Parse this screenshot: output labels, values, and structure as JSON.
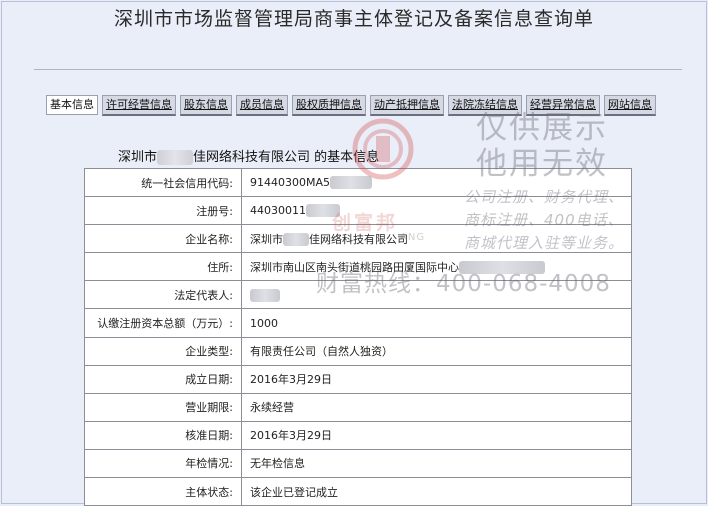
{
  "page": {
    "title": "深圳市市场监督管理局商事主体登记及备案信息查询单"
  },
  "tabs": [
    {
      "label": "基本信息",
      "active": true
    },
    {
      "label": "许可经营信息"
    },
    {
      "label": "股东信息"
    },
    {
      "label": "成员信息"
    },
    {
      "label": "股权质押信息"
    },
    {
      "label": "动产抵押信息"
    },
    {
      "label": "法院冻结信息"
    },
    {
      "label": "经营异常信息"
    },
    {
      "label": "网站信息"
    }
  ],
  "company": {
    "prefix": "深圳市",
    "suffix": "佳网络科技有限公司",
    "heading_tail": "的基本信息"
  },
  "rows": {
    "credit_code": {
      "label": "统一社会信用代码:",
      "value": "91440300MA5"
    },
    "reg_no": {
      "label": "注册号:",
      "value": "44030011"
    },
    "name": {
      "label": "企业名称:",
      "prefix": "深圳市",
      "suffix": "佳网络科技有限公司"
    },
    "address": {
      "label": "住所:",
      "value": "深圳市南山区南头街道桃园路田厦国际中心"
    },
    "legal_rep": {
      "label": "法定代表人:"
    },
    "capital": {
      "label": "认缴注册资本总额（万元）:",
      "value": "1000"
    },
    "type": {
      "label": "企业类型:",
      "value": "有限责任公司（自然人独资）"
    },
    "est_date": {
      "label": "成立日期:",
      "value": "2016年3月29日"
    },
    "term": {
      "label": "营业期限:",
      "value": "永续经营"
    },
    "approve_date": {
      "label": "核准日期:",
      "value": "2016年3月29日"
    },
    "annual": {
      "label": "年检情况:",
      "value": "无年检信息"
    },
    "status": {
      "label": "主体状态:",
      "value": "该企业已登记成立"
    }
  },
  "watermark": {
    "line1": "仅供展示",
    "line2": "他用无效",
    "services": [
      "公司注册、财务代理、",
      "商标注册、400电话、",
      "商城代理入驻等业务。"
    ],
    "brand": "创富邦",
    "brand_en": "ANG",
    "hotline": "财富热线：400-068-4008",
    "colors": {
      "logo": "#d24a4a",
      "text": "#6e6e78"
    }
  }
}
